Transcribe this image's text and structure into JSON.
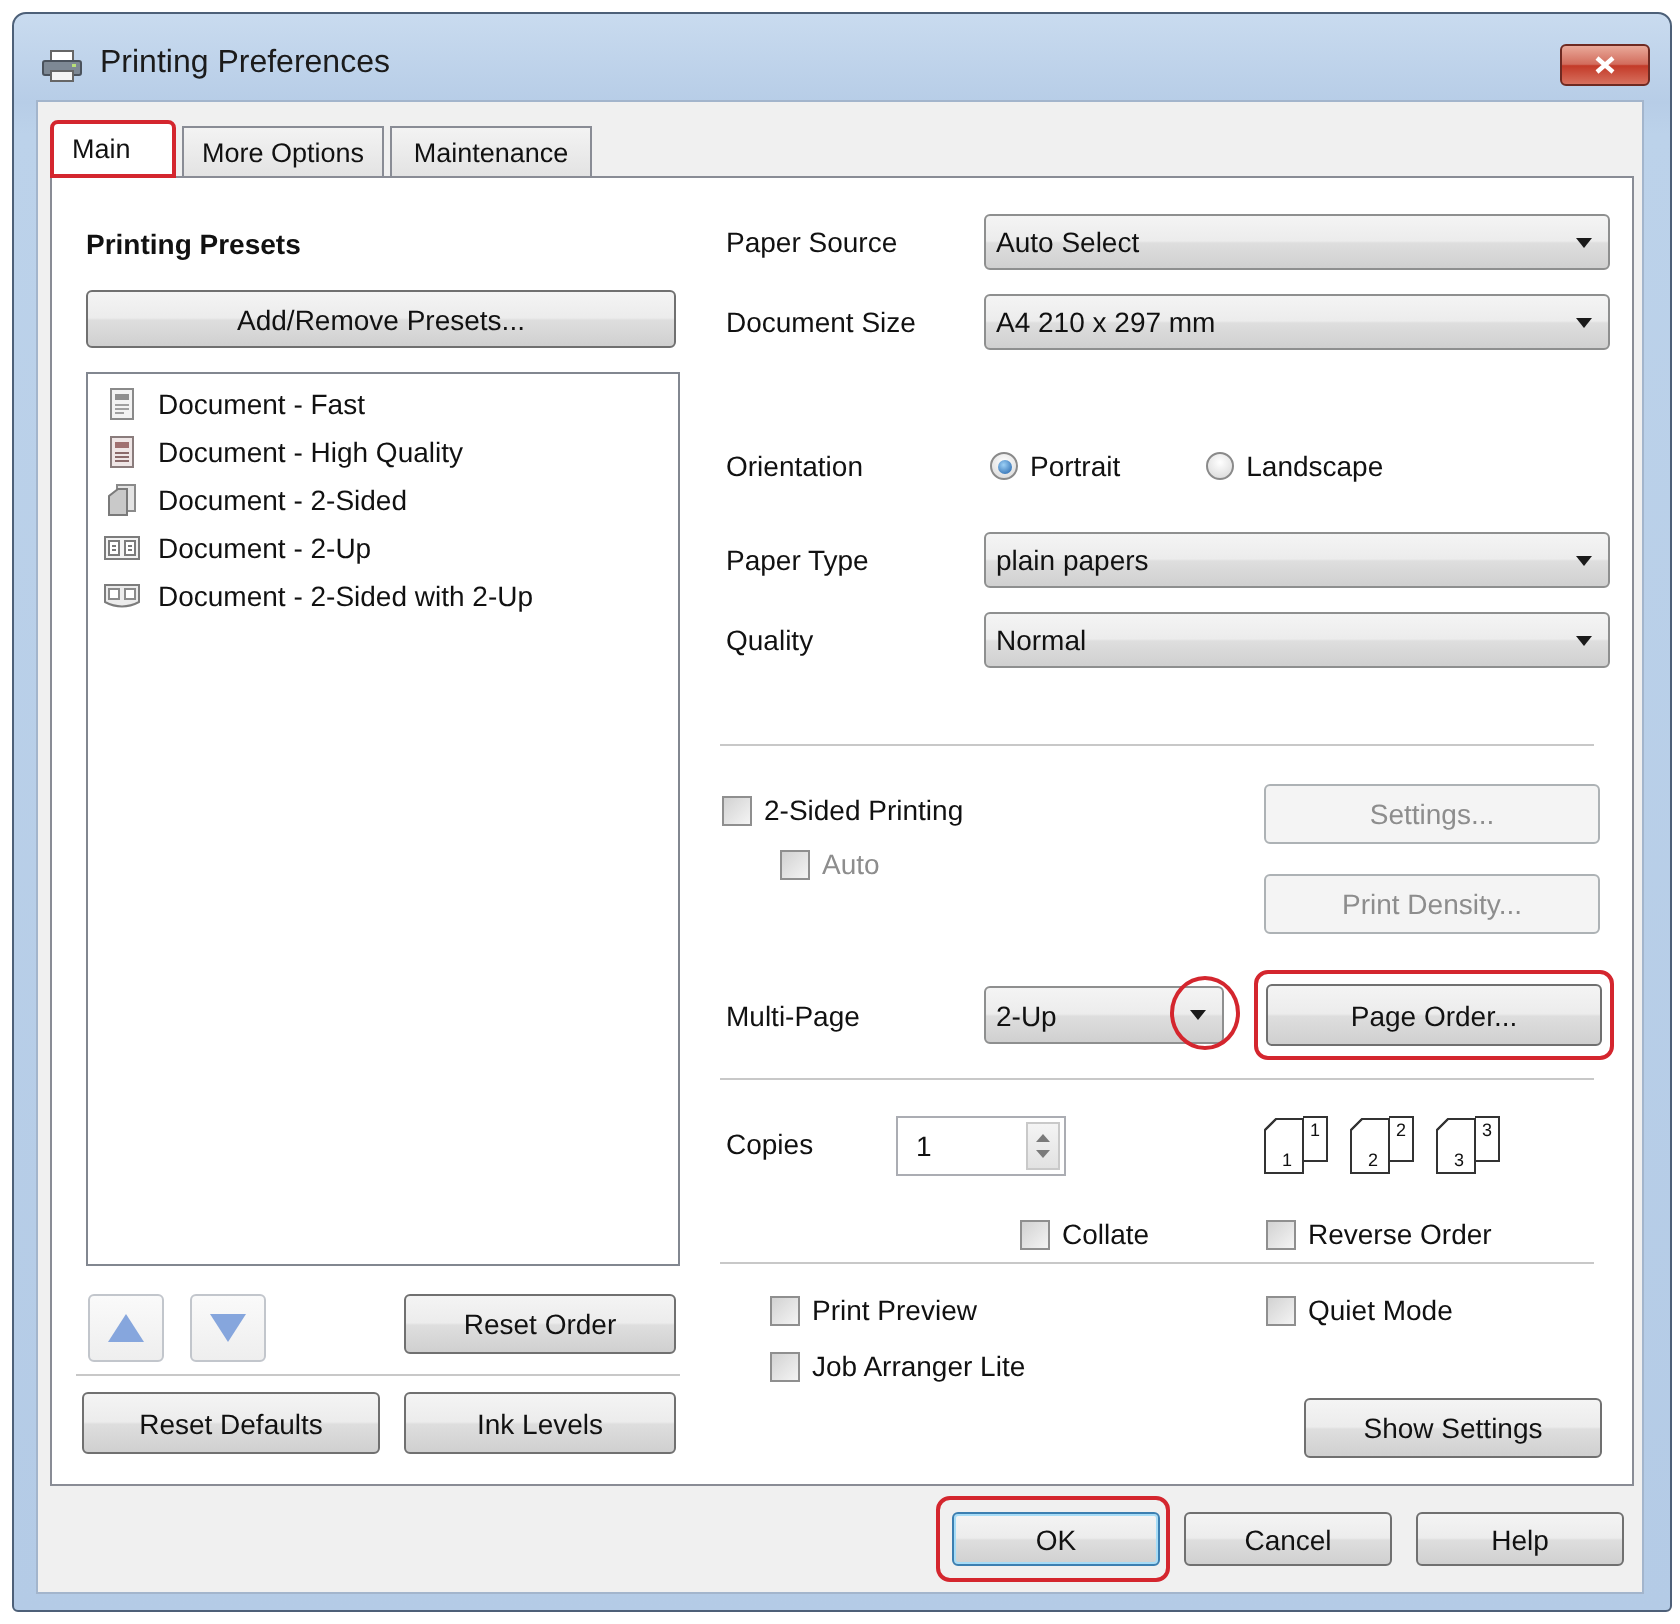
{
  "window": {
    "title": "Printing Preferences"
  },
  "tabs": [
    {
      "label": "Main",
      "selected": true,
      "highlighted": true
    },
    {
      "label": "More Options",
      "selected": false,
      "highlighted": false
    },
    {
      "label": "Maintenance",
      "selected": false,
      "highlighted": false
    }
  ],
  "presets": {
    "title": "Printing Presets",
    "add_button": "Add/Remove Presets...",
    "items": [
      {
        "label": "Document - Fast",
        "kind": "fast",
        "selected": false
      },
      {
        "label": "Document - High Quality",
        "kind": "quality",
        "selected": false
      },
      {
        "label": "Document - 2-Sided",
        "kind": "two_sided",
        "selected": false
      },
      {
        "label": "Document - 2-Up",
        "kind": "two_up",
        "selected": false
      },
      {
        "label": "Document - 2-Sided with 2-Up",
        "kind": "two_sided_two_up",
        "selected": false
      }
    ],
    "reset_order_button": "Reset Order"
  },
  "paper_source": {
    "label": "Paper Source",
    "value": "Auto Select"
  },
  "document_size": {
    "label": "Document Size",
    "value": "A4 210 x 297 mm"
  },
  "orientation": {
    "label": "Orientation",
    "options": [
      {
        "label": "Portrait",
        "selected": true
      },
      {
        "label": "Landscape",
        "selected": false
      }
    ]
  },
  "paper_type": {
    "label": "Paper Type",
    "value": "plain papers"
  },
  "quality": {
    "label": "Quality",
    "value": "Normal"
  },
  "two_sided_printing": {
    "label": "2-Sided Printing",
    "checked": false,
    "disabled": false
  },
  "auto": {
    "label": "Auto",
    "checked": false,
    "disabled": true
  },
  "side_buttons": [
    {
      "label": "Settings...",
      "disabled": true
    },
    {
      "label": "Print Density...",
      "disabled": true
    }
  ],
  "multi_page": {
    "label": "Multi-Page",
    "value": "2-Up",
    "arrow_highlighted": true
  },
  "page_order_button": {
    "label": "Page Order...",
    "highlighted": true
  },
  "copies": {
    "label": "Copies",
    "value": "1"
  },
  "page_stacks": [
    {
      "front": "1",
      "back": "1"
    },
    {
      "front": "2",
      "back": "2"
    },
    {
      "front": "3",
      "back": "3"
    }
  ],
  "collate": {
    "label": "Collate",
    "checked": false,
    "disabled": false
  },
  "reverse_order": {
    "label": "Reverse Order",
    "checked": false,
    "disabled": false
  },
  "print_preview": {
    "label": "Print Preview",
    "checked": false,
    "disabled": false
  },
  "quiet_mode": {
    "label": "Quiet Mode",
    "checked": false,
    "disabled": false
  },
  "job_arranger_lite": {
    "label": "Job Arranger Lite",
    "checked": false,
    "disabled": false
  },
  "show_settings_button": "Show Settings",
  "reset_defaults_button": "Reset Defaults",
  "ink_levels_button": "Ink Levels",
  "dialog_buttons": [
    {
      "label": "OK",
      "default": true,
      "highlighted": true
    },
    {
      "label": "Cancel",
      "default": false,
      "highlighted": false
    },
    {
      "label": "Help",
      "default": false,
      "highlighted": false
    }
  ]
}
